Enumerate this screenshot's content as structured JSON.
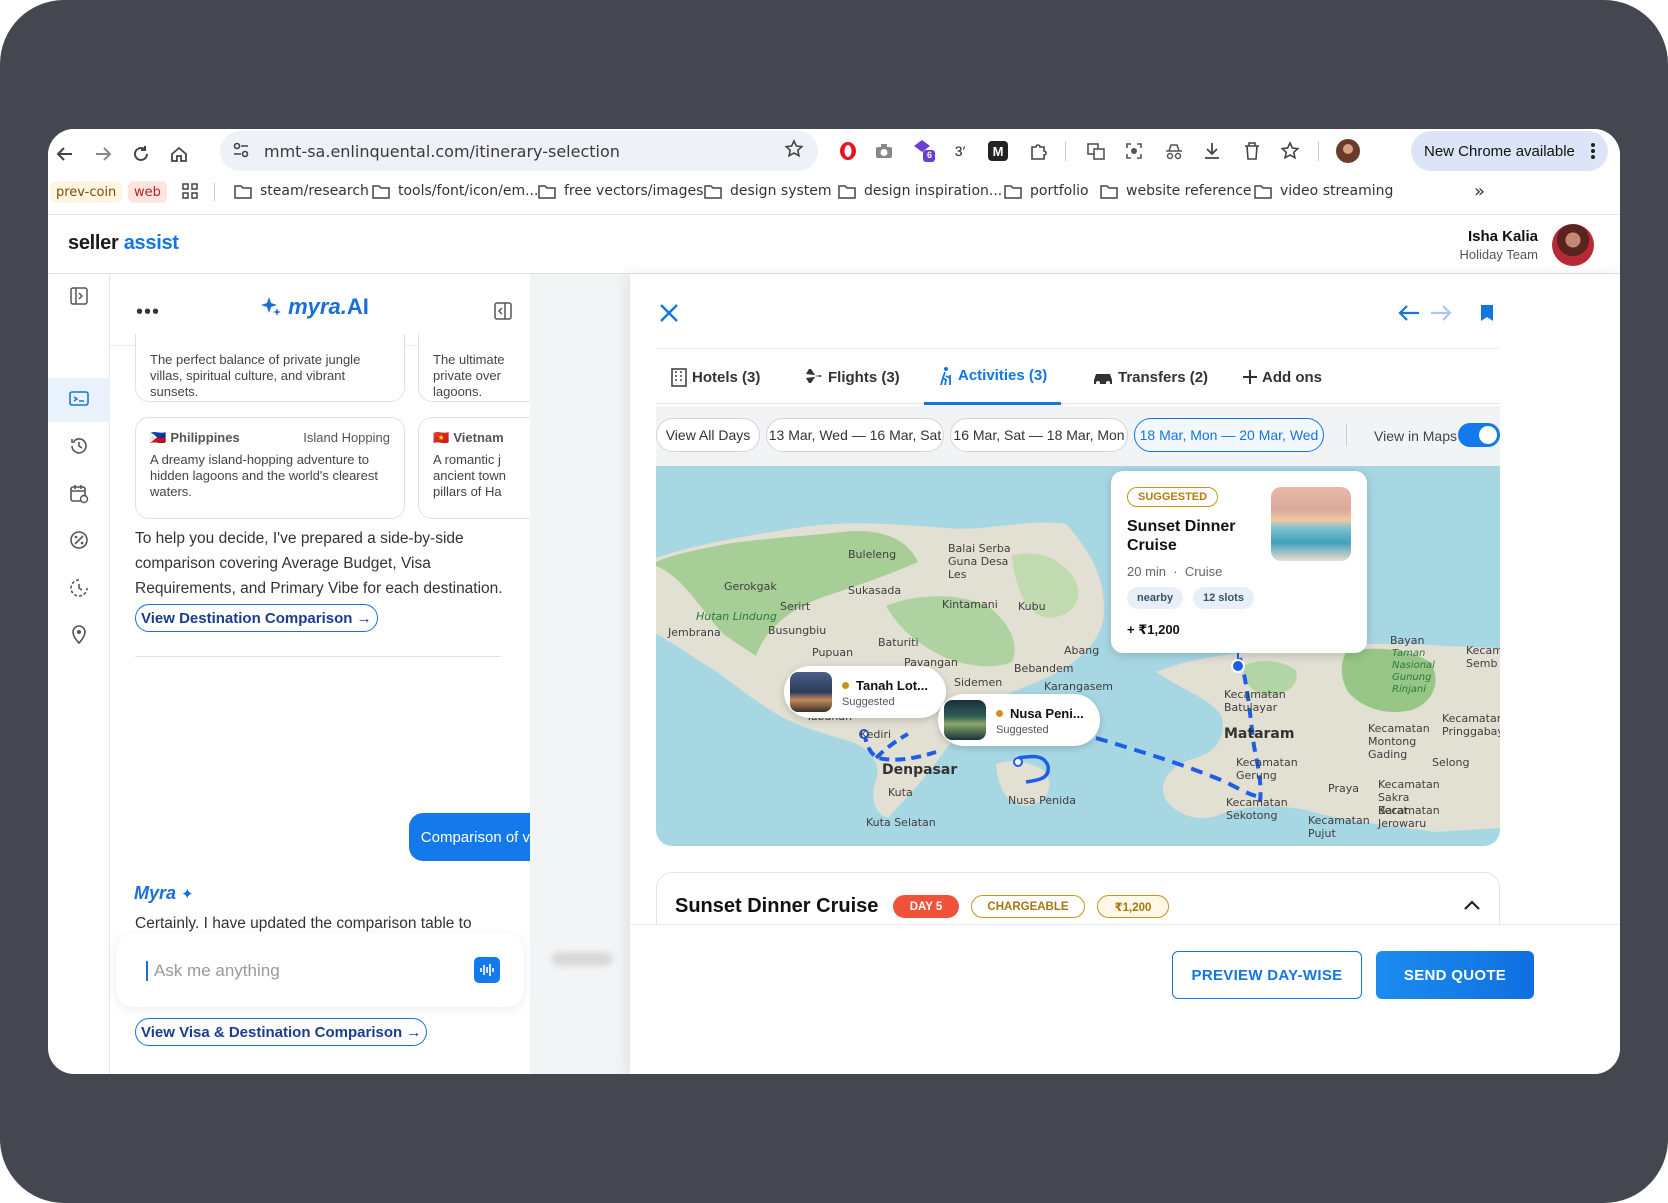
{
  "browser": {
    "url": "mmt-sa.enlinquental.com/itinerary-selection",
    "extension_badge": "6",
    "extension_text": "3′",
    "new_chrome_label": "New Chrome available",
    "chips": [
      "prev-coin",
      "web"
    ],
    "bookmarks": [
      "steam/research",
      "tools/font/icon/em...",
      "free vectors/images",
      "design system",
      "design inspiration...",
      "portfolio",
      "website reference",
      "video streaming"
    ],
    "more": "»"
  },
  "app": {
    "logo_a": "seller",
    "logo_b": "assist",
    "user_name": "Isha Kalia",
    "user_team": "Holiday Team"
  },
  "chat": {
    "brand": "myra.",
    "brand_ai": "AI",
    "card1_text": "The perfect balance of private jungle villas, spiritual culture, and vibrant sunsets.",
    "card2_text": "The ultimate private over lagoons.",
    "card3": {
      "flag": "🇵🇭",
      "title": "Philippines",
      "tag": "Island Hopping",
      "text": "A dreamy island-hopping adventure to hidden lagoons and the world's clearest waters."
    },
    "card4": {
      "flag": "🇻🇳",
      "title": "Vietnam",
      "text": "A romantic j ancient town pillars of Ha"
    },
    "para1": "To help you decide, I've prepared a side-by-side comparison covering Average Budget, Visa Requirements, and Primary Vibe for each destination.",
    "link1": "View Destination Comparison →",
    "user_msg": "Comparison of visa",
    "assistant_name": "Myra",
    "para2": "Certainly. I have updated the comparison table to highlight Visa Policies (Visa-on-Arrival vs. E-Visa) for each destination, alongside the budget and primary vibe.",
    "link2": "View Visa & Destination Comparison →",
    "input_placeholder": "Ask me anything"
  },
  "modal": {
    "tabs": [
      "Hotels (3)",
      "Flights (3)",
      "Activities (3)",
      "Transfers (2)",
      "Add ons"
    ],
    "active_tab": "Activities (3)",
    "day_chips": [
      "View All Days",
      "13 Mar, Wed — 16 Mar, Sat",
      "16 Mar, Sat — 18 Mar, Mon",
      "18 Mar, Mon — 20 Mar, Wed"
    ],
    "active_day": "18 Mar, Mon — 20 Mar, Wed",
    "view_in_maps": "View in Maps",
    "view_in_maps_on": true,
    "map_labels": [
      "Buleleng",
      "Balai Serba Guna Desa Les",
      "Gerokgak",
      "Sukasada",
      "Serirt",
      "Hutan Lindung",
      "Kintamani",
      "Kubu",
      "Jembrana",
      "Busungbiu",
      "Baturiti",
      "Pupuan",
      "Abang",
      "Pavangan",
      "Bebandem",
      "Karangasem",
      "Sidemen",
      "Tabanan",
      "Kediri",
      "Denpasar",
      "Kuta",
      "Kuta Selatan",
      "Nusa Penida",
      "Bayan",
      "Taman Nasional Gunung Rinjani",
      "Kecamatan Batulayar",
      "Mataram",
      "Kecamatan Gerung",
      "Kecamatan Sekotong",
      "Kecamatan Montong Gading",
      "Kecamatan Pringgabaya",
      "Selong",
      "Praya",
      "Kecamatan Sakra Barat",
      "Kecamatan Jerowaru",
      "Kecamatan Pujut",
      "Kecam Semb"
    ],
    "popup": {
      "badge": "SUGGESTED",
      "title": "Sunset Dinner Cruise",
      "duration": "20 min",
      "sep": "·",
      "category": "Cruise",
      "tags": [
        "nearby",
        "12 slots"
      ],
      "price": "+ ₹1,200"
    },
    "mini1": {
      "title": "Tanah Lot...",
      "sub": "Suggested"
    },
    "mini2": {
      "title": "Nusa Peni...",
      "sub": "Suggested"
    },
    "detail_title": "Sunset Dinner Cruise",
    "detail_badges": [
      "DAY 5",
      "CHARGEABLE",
      "₹1,200"
    ],
    "preview_btn": "PREVIEW DAY-WISE",
    "send_btn": "SEND QUOTE"
  },
  "colors": {
    "primary": "#1376e0",
    "gold": "#c9941a",
    "day_badge": "#f0523a"
  }
}
